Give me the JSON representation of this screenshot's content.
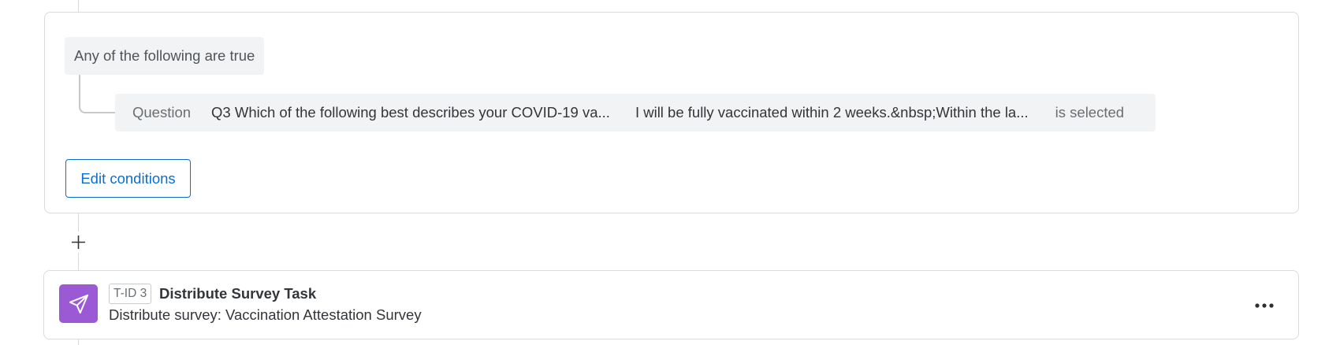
{
  "condition_block": {
    "group_label": "Any of the following are true",
    "condition": {
      "type": "Question",
      "question": "Q3 Which of the following best describes your COVID-19 va...",
      "answer": "I will be fully vaccinated within 2 weeks.&nbsp;Within the la...",
      "operator": "is selected"
    },
    "edit_button_label": "Edit conditions"
  },
  "add_step": {
    "icon": "plus-icon"
  },
  "task": {
    "id_badge": "T-ID 3",
    "title": "Distribute Survey Task",
    "subtitle": "Distribute survey: Vaccination Attestation Survey",
    "icon": "paper-plane-icon",
    "icon_color": "#9b59d6",
    "more_icon": "more-horizontal-icon"
  },
  "colors": {
    "accent": "#0b6ed0",
    "task_icon_bg": "#9b59d6",
    "border": "#d9dbde",
    "chip_bg": "#f2f3f4"
  }
}
